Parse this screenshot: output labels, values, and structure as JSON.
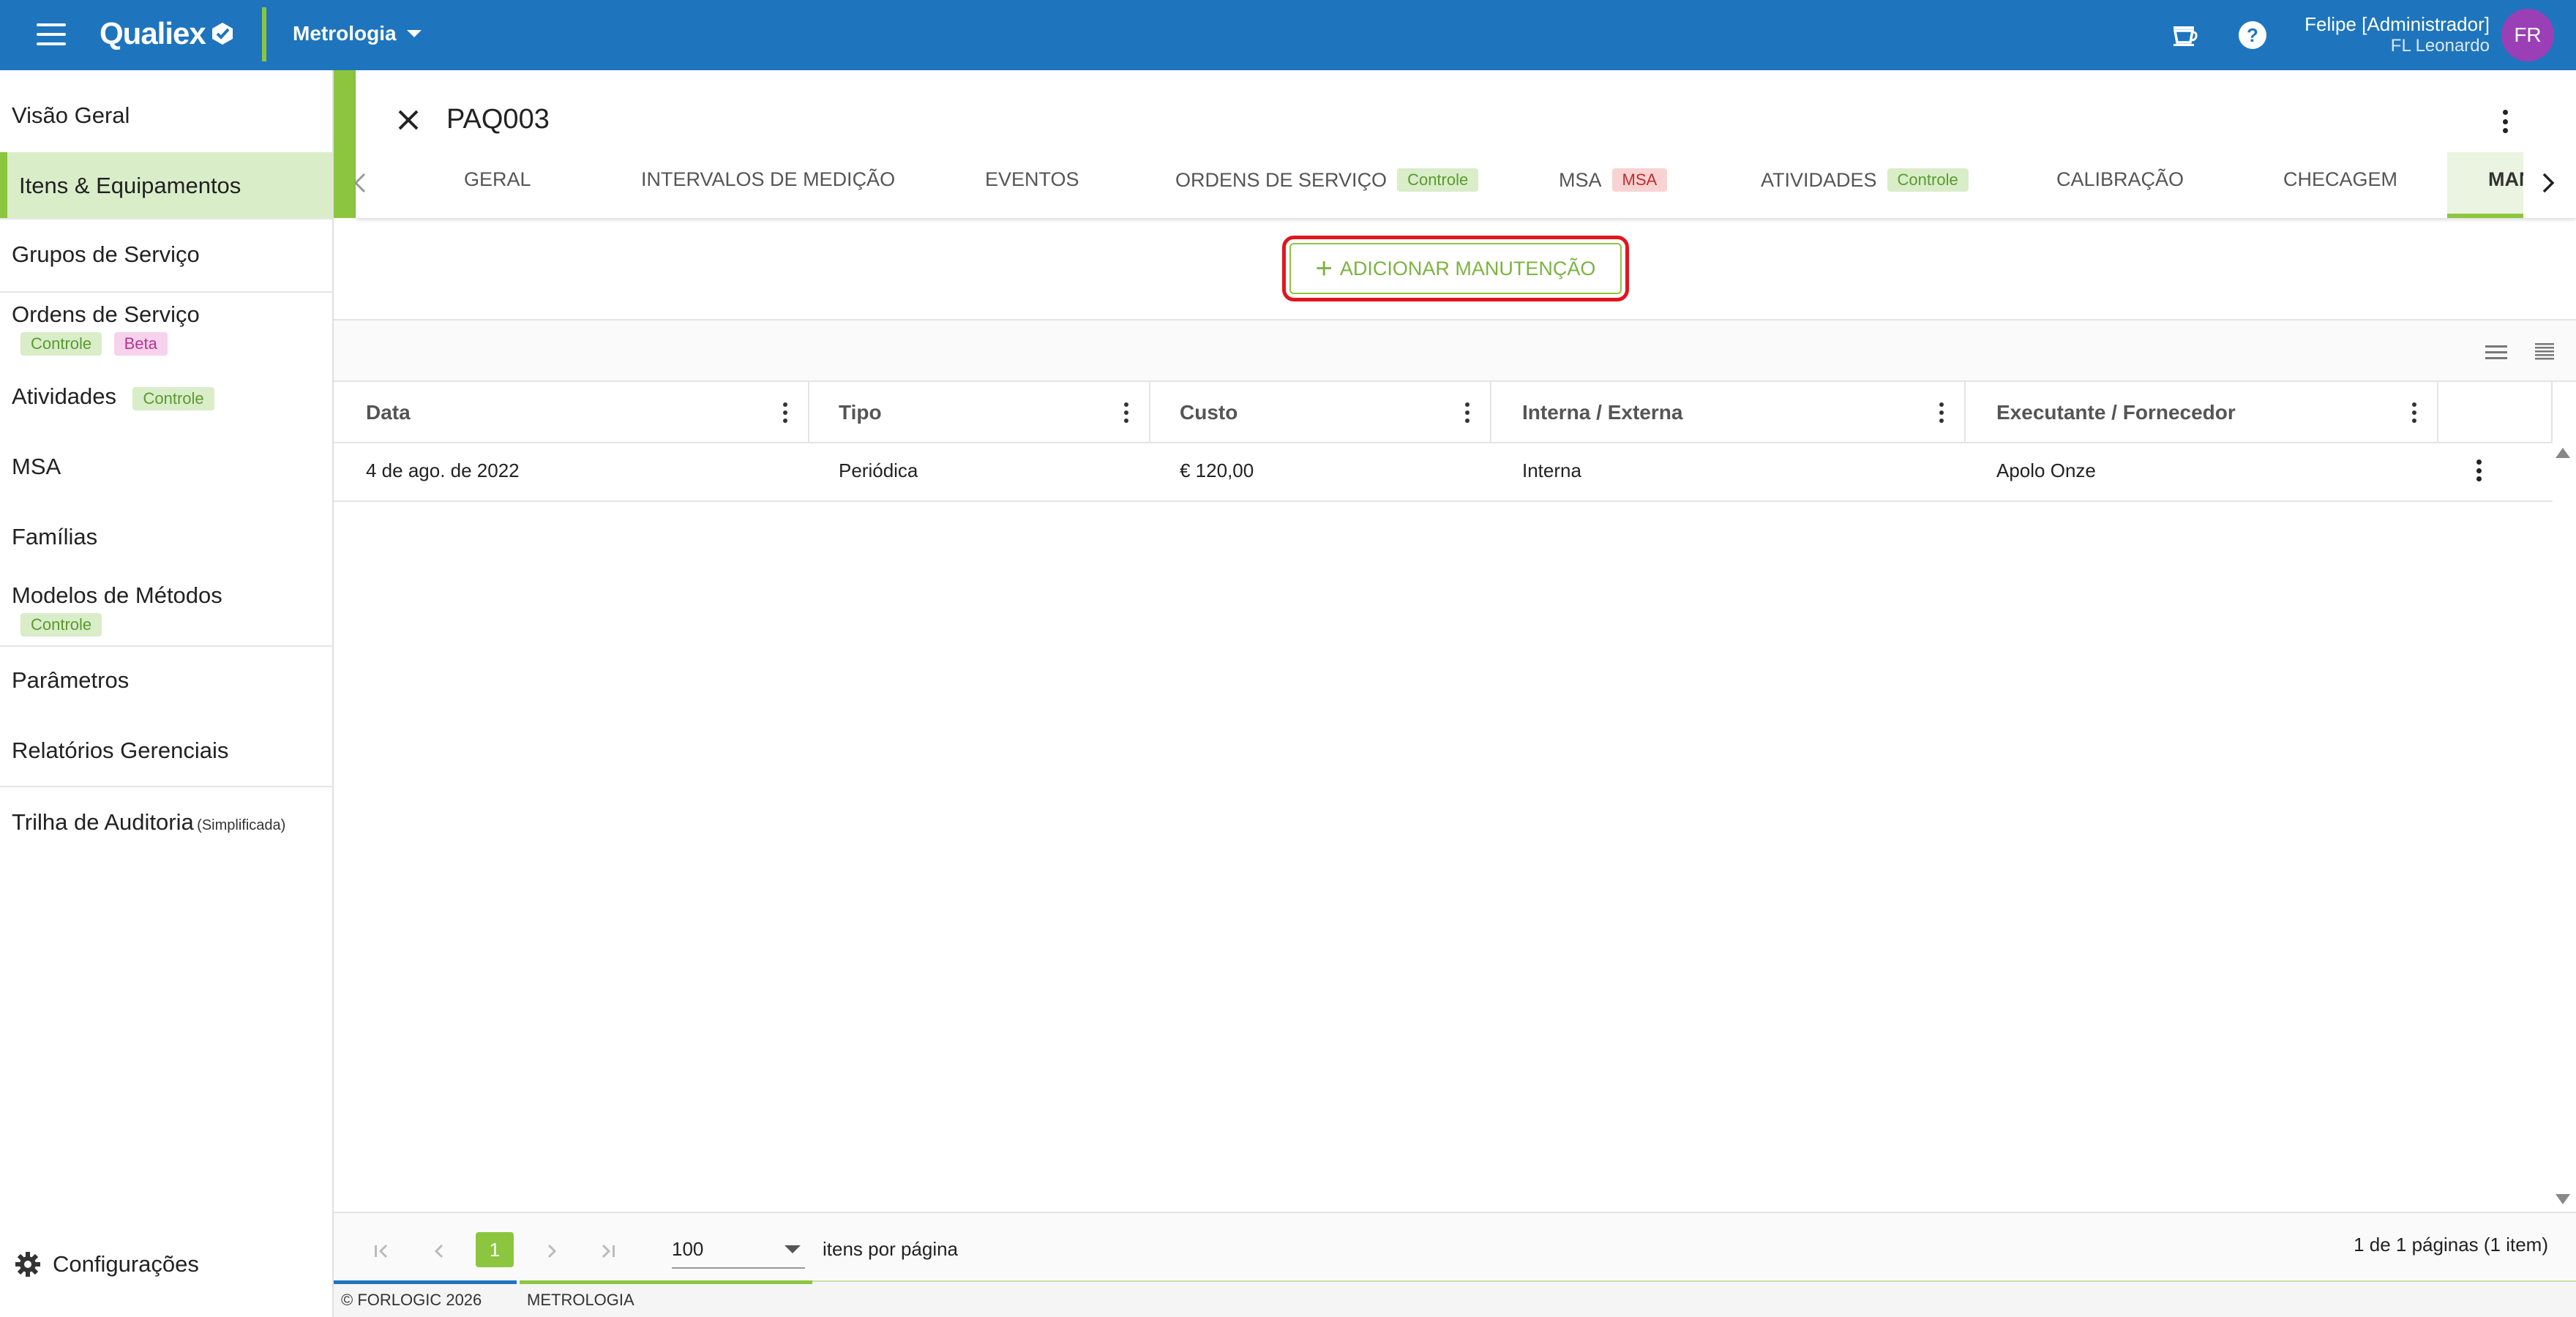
{
  "topbar": {
    "logo": "Qualiex",
    "module": "Metrologia",
    "user_name": "Felipe [Administrador]",
    "user_org": "FL Leonardo",
    "avatar_initials": "FR",
    "brand_color": "#1e75bd",
    "accent_color": "#8cc63f"
  },
  "sidebar": {
    "items": [
      {
        "label": "Visão Geral"
      },
      {
        "label": "Itens & Equipamentos"
      },
      {
        "label": "Grupos de Serviço"
      },
      {
        "label": "Ordens de Serviço",
        "tags": [
          "Controle",
          "Beta"
        ]
      },
      {
        "label": "Atividades",
        "tags": [
          "Controle"
        ]
      },
      {
        "label": "MSA"
      },
      {
        "label": "Famílias"
      },
      {
        "label": "Modelos de Métodos",
        "tags": [
          "Controle"
        ]
      },
      {
        "label": "Parâmetros"
      },
      {
        "label": "Relatórios Gerenciais"
      },
      {
        "label": "Trilha de Auditoria",
        "note": "(Simplificada)"
      }
    ],
    "active_index": 1,
    "config_label": "Configurações"
  },
  "detail": {
    "title": "PAQ003",
    "tabs": [
      {
        "label": "GERAL"
      },
      {
        "label": "INTERVALOS DE MEDIÇÃO"
      },
      {
        "label": "EVENTOS"
      },
      {
        "label": "ORDENS DE SERVIÇO",
        "tag": "Controle"
      },
      {
        "label": "MSA",
        "tag": "MSA"
      },
      {
        "label": "ATIVIDADES",
        "tag": "Controle"
      },
      {
        "label": "CALIBRAÇÃO"
      },
      {
        "label": "CHECAGEM"
      },
      {
        "label": "MANUTENÇÃO"
      }
    ],
    "add_button": "ADICIONAR MANUTENÇÃO"
  },
  "grid": {
    "columns": [
      "Data",
      "Tipo",
      "Custo",
      "Interna / Externa",
      "Executante / Fornecedor"
    ],
    "rows": [
      [
        "4 de ago. de 2022",
        "Periódica",
        "€ 120,00",
        "Interna",
        "Apolo Onze"
      ]
    ]
  },
  "pager": {
    "current_page": "1",
    "page_size": "100",
    "page_size_label": "itens por página",
    "info": "1 de 1 páginas (1 item)"
  },
  "footer": {
    "copyright": "© FORLOGIC 2026",
    "module": "METROLOGIA"
  }
}
